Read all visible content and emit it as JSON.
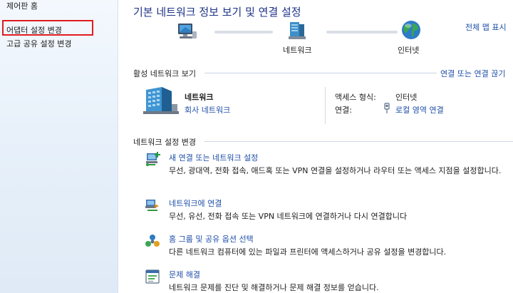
{
  "nav": {
    "home": "제어판 홈",
    "adapter": "어댑터 설정 변경",
    "advanced": "고급 공유 설정 변경"
  },
  "title": "기본 네트워크 정보 보기 및 연결 설정",
  "map": {
    "link": "전체 맵 표시",
    "network_label": "네트워크",
    "internet_label": "인터넷"
  },
  "active": {
    "header": "활성 네트워크 보기",
    "connect_link": "연결 또는 연결 끊기",
    "network_name": "네트워크",
    "network_type": "회사 네트워크",
    "access_label": "액세스 형식:",
    "access_value": "인터넷",
    "connection_label": "연결:",
    "connection_value": "로컬 영역 연결"
  },
  "change": {
    "header": "네트워크 설정 변경",
    "tasks": [
      {
        "title": "새 연결 또는 네트워크 설정",
        "desc": "무선, 광대역, 전화 접속, 애드혹 또는 VPN 연결을 설정하거나 라우터 또는 액세스 지점을 설정합니다.",
        "icon": "new-connection-icon"
      },
      {
        "title": "네트워크에 연결",
        "desc": "무선, 유선, 전화 접속 또는 VPN 네트워크에 연결하거나 다시 연결합니다",
        "icon": "connect-network-icon"
      },
      {
        "title": "홈 그룹 및 공유 옵션 선택",
        "desc": "다른 네트워크 컴퓨터에 있는 파일과 프린터에 액세스하거나 공유 설정을 변경합니다.",
        "icon": "homegroup-icon"
      },
      {
        "title": "문제 해결",
        "desc": "네트워크 문제를 진단 및 해결하거나 문제 해결 정보를 얻습니다.",
        "icon": "troubleshoot-icon"
      }
    ]
  },
  "colors": {
    "title": "#1e3287",
    "link": "#1f4fa8",
    "highlight": "#e11b22",
    "nav_bg": "#e8f1fa"
  }
}
